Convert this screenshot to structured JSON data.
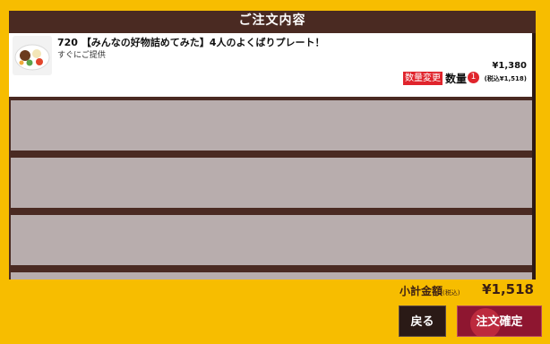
{
  "header": {
    "title": "ご注文内容"
  },
  "order_items": [
    {
      "number": "720",
      "name": "【みんなの好物詰めてみた】4人のよくばりプレート！",
      "subtitle": "すぐにご提供",
      "change_label": "数量変更",
      "quantity_label": "数量",
      "quantity": "1",
      "price": "¥1,380",
      "price_with_tax": "(税込¥1,518)",
      "thumbnail_icon": "food-plate-icon"
    }
  ],
  "summary": {
    "subtotal_label": "小計金額",
    "tax_note": "(税込)",
    "subtotal_value": "¥1,518"
  },
  "footer": {
    "back_label": "戻る",
    "confirm_label": "注文確定"
  },
  "colors": {
    "background": "#f7bd00",
    "panel": "#4a2a22",
    "accent_red": "#e0242c",
    "confirm": "#8e1630",
    "empty_row": "#b8adad"
  }
}
